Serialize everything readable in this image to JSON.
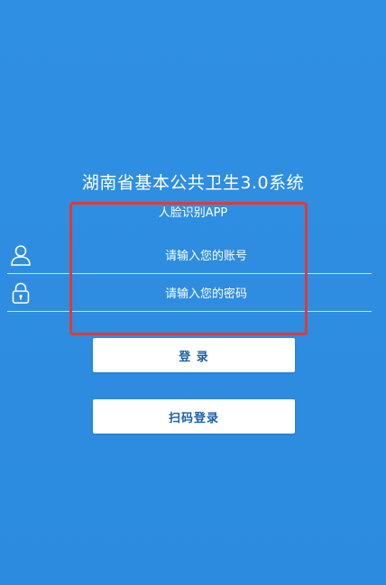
{
  "app": {
    "title": "湖南省基本公共卫生3.0系统",
    "subtitle": "人脸识别APP"
  },
  "form": {
    "account_placeholder": "请输入您的账号",
    "password_placeholder": "请输入您的密码",
    "account_icon": "user-icon",
    "password_icon": "lock-icon"
  },
  "buttons": {
    "login_label": "登 录",
    "scan_login_label": "扫码登录"
  },
  "colors": {
    "background": "#2e8de0",
    "button_text": "#1b5fa8",
    "highlight_border": "#e03a3a"
  }
}
